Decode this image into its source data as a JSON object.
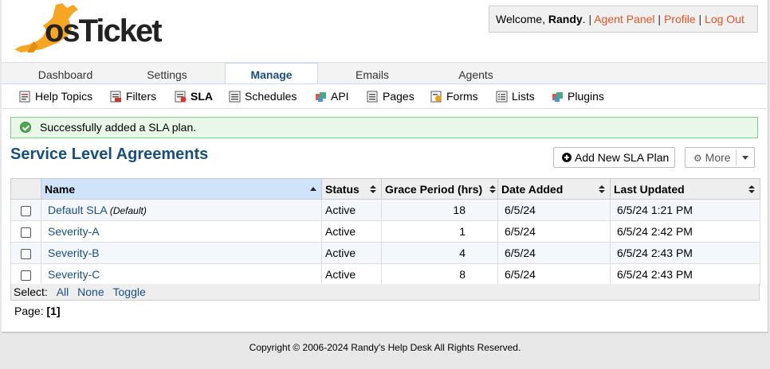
{
  "brand": {
    "logo_text": "osTicket"
  },
  "user_bar": {
    "welcome_prefix": "Welcome, ",
    "username": "Randy",
    "welcome_suffix": ".",
    "separator": "|",
    "links": [
      "Agent Panel",
      "Profile",
      "Log Out"
    ]
  },
  "nav": {
    "tabs": [
      "Dashboard",
      "Settings",
      "Manage",
      "Emails",
      "Agents"
    ],
    "active_tab": "Manage"
  },
  "subnav": {
    "items": [
      {
        "label": "Help Topics",
        "icon": "help-topics-icon"
      },
      {
        "label": "Filters",
        "icon": "filters-icon"
      },
      {
        "label": "SLA",
        "icon": "sla-icon"
      },
      {
        "label": "Schedules",
        "icon": "schedules-icon"
      },
      {
        "label": "API",
        "icon": "api-icon"
      },
      {
        "label": "Pages",
        "icon": "pages-icon"
      },
      {
        "label": "Forms",
        "icon": "forms-icon"
      },
      {
        "label": "Lists",
        "icon": "lists-icon"
      },
      {
        "label": "Plugins",
        "icon": "plugins-icon"
      }
    ],
    "active_item": "SLA"
  },
  "notice": {
    "text": "Successfully added a SLA plan."
  },
  "page": {
    "title": "Service Level Agreements",
    "add_button": "Add New SLA Plan",
    "more_button": "More"
  },
  "table": {
    "headers": [
      "Name",
      "Status",
      "Grace Period (hrs)",
      "Date Added",
      "Last Updated"
    ],
    "rows": [
      {
        "name": "Default SLA",
        "tag": "(Default)",
        "status": "Active",
        "grace": "18",
        "added": "6/5/24",
        "updated": "6/5/24 1:21 PM"
      },
      {
        "name": "Severity-A",
        "tag": "",
        "status": "Active",
        "grace": "1",
        "added": "6/5/24",
        "updated": "6/5/24 2:42 PM"
      },
      {
        "name": "Severity-B",
        "tag": "",
        "status": "Active",
        "grace": "4",
        "added": "6/5/24",
        "updated": "6/5/24 2:43 PM"
      },
      {
        "name": "Severity-C",
        "tag": "",
        "status": "Active",
        "grace": "8",
        "added": "6/5/24",
        "updated": "6/5/24 2:43 PM"
      }
    ]
  },
  "select": {
    "label": "Select:",
    "options": [
      "All",
      "None",
      "Toggle"
    ]
  },
  "pagination": {
    "label": "Page:",
    "current": "[1]"
  },
  "footer": {
    "text": "Copyright © 2006-2024 Randy's Help Desk All Rights Reserved."
  },
  "colors": {
    "link": "#184e81",
    "user_link": "#e25324",
    "logo_orange": "#f5a623",
    "success_bg": "#e8f7e8",
    "success_border": "#7fd37f",
    "sorted_header": "#cfe4fa"
  }
}
